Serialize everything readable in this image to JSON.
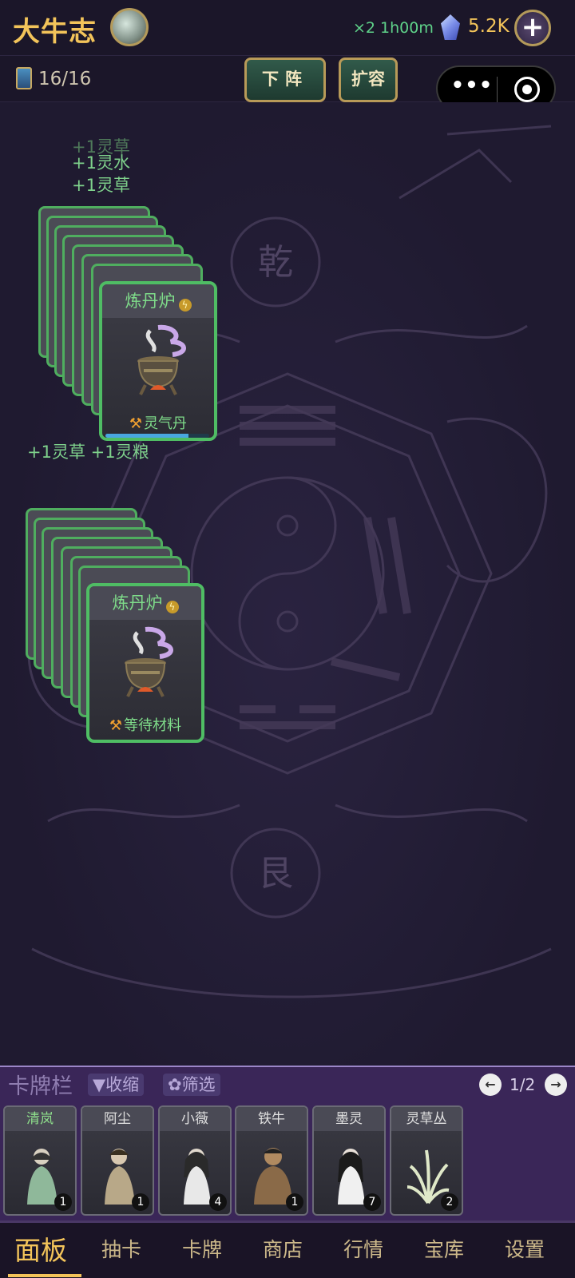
{
  "header": {
    "title": "大牛志",
    "speed": "×2 1h00m",
    "gem_count": "5.2K",
    "add_label": "+"
  },
  "subbar": {
    "deck_count": "16/16",
    "btn_down": "下阵",
    "btn_expand": "扩容",
    "capsule_more": "•••"
  },
  "board": {
    "gains_top": [
      "+1灵草",
      "+1灵水",
      "+1灵草"
    ],
    "gains_mid": "+1灵草  +1灵粮",
    "stack1": {
      "title": "炼丹炉",
      "status": "灵气丹",
      "progress": 0.8
    },
    "stack2": {
      "title": "炼丹炉",
      "status": "等待材料"
    },
    "trigram_top": "乾",
    "trigram_bottom": "艮"
  },
  "cardbar": {
    "title": "卡牌栏",
    "collapse": "▼收缩",
    "filter": "✿筛选",
    "page": "1/2",
    "prev": "←",
    "next": "→",
    "cards": [
      {
        "name": "清岚",
        "count": "1",
        "highlight": true
      },
      {
        "name": "阿尘",
        "count": "1",
        "highlight": false
      },
      {
        "name": "小薇",
        "count": "4",
        "highlight": false
      },
      {
        "name": "铁牛",
        "count": "1",
        "highlight": false
      },
      {
        "name": "墨灵",
        "count": "7",
        "highlight": false
      },
      {
        "name": "灵草丛",
        "count": "2",
        "highlight": false
      }
    ]
  },
  "nav": {
    "items": [
      "面板",
      "抽卡",
      "卡牌",
      "商店",
      "行情",
      "宝库",
      "设置"
    ],
    "active": 0
  },
  "colors": {
    "accent_gold": "#f3c45a",
    "green_text": "#7fdc8a",
    "card_border": "#4fbd64",
    "cardbar_bg": "#3a2658"
  }
}
